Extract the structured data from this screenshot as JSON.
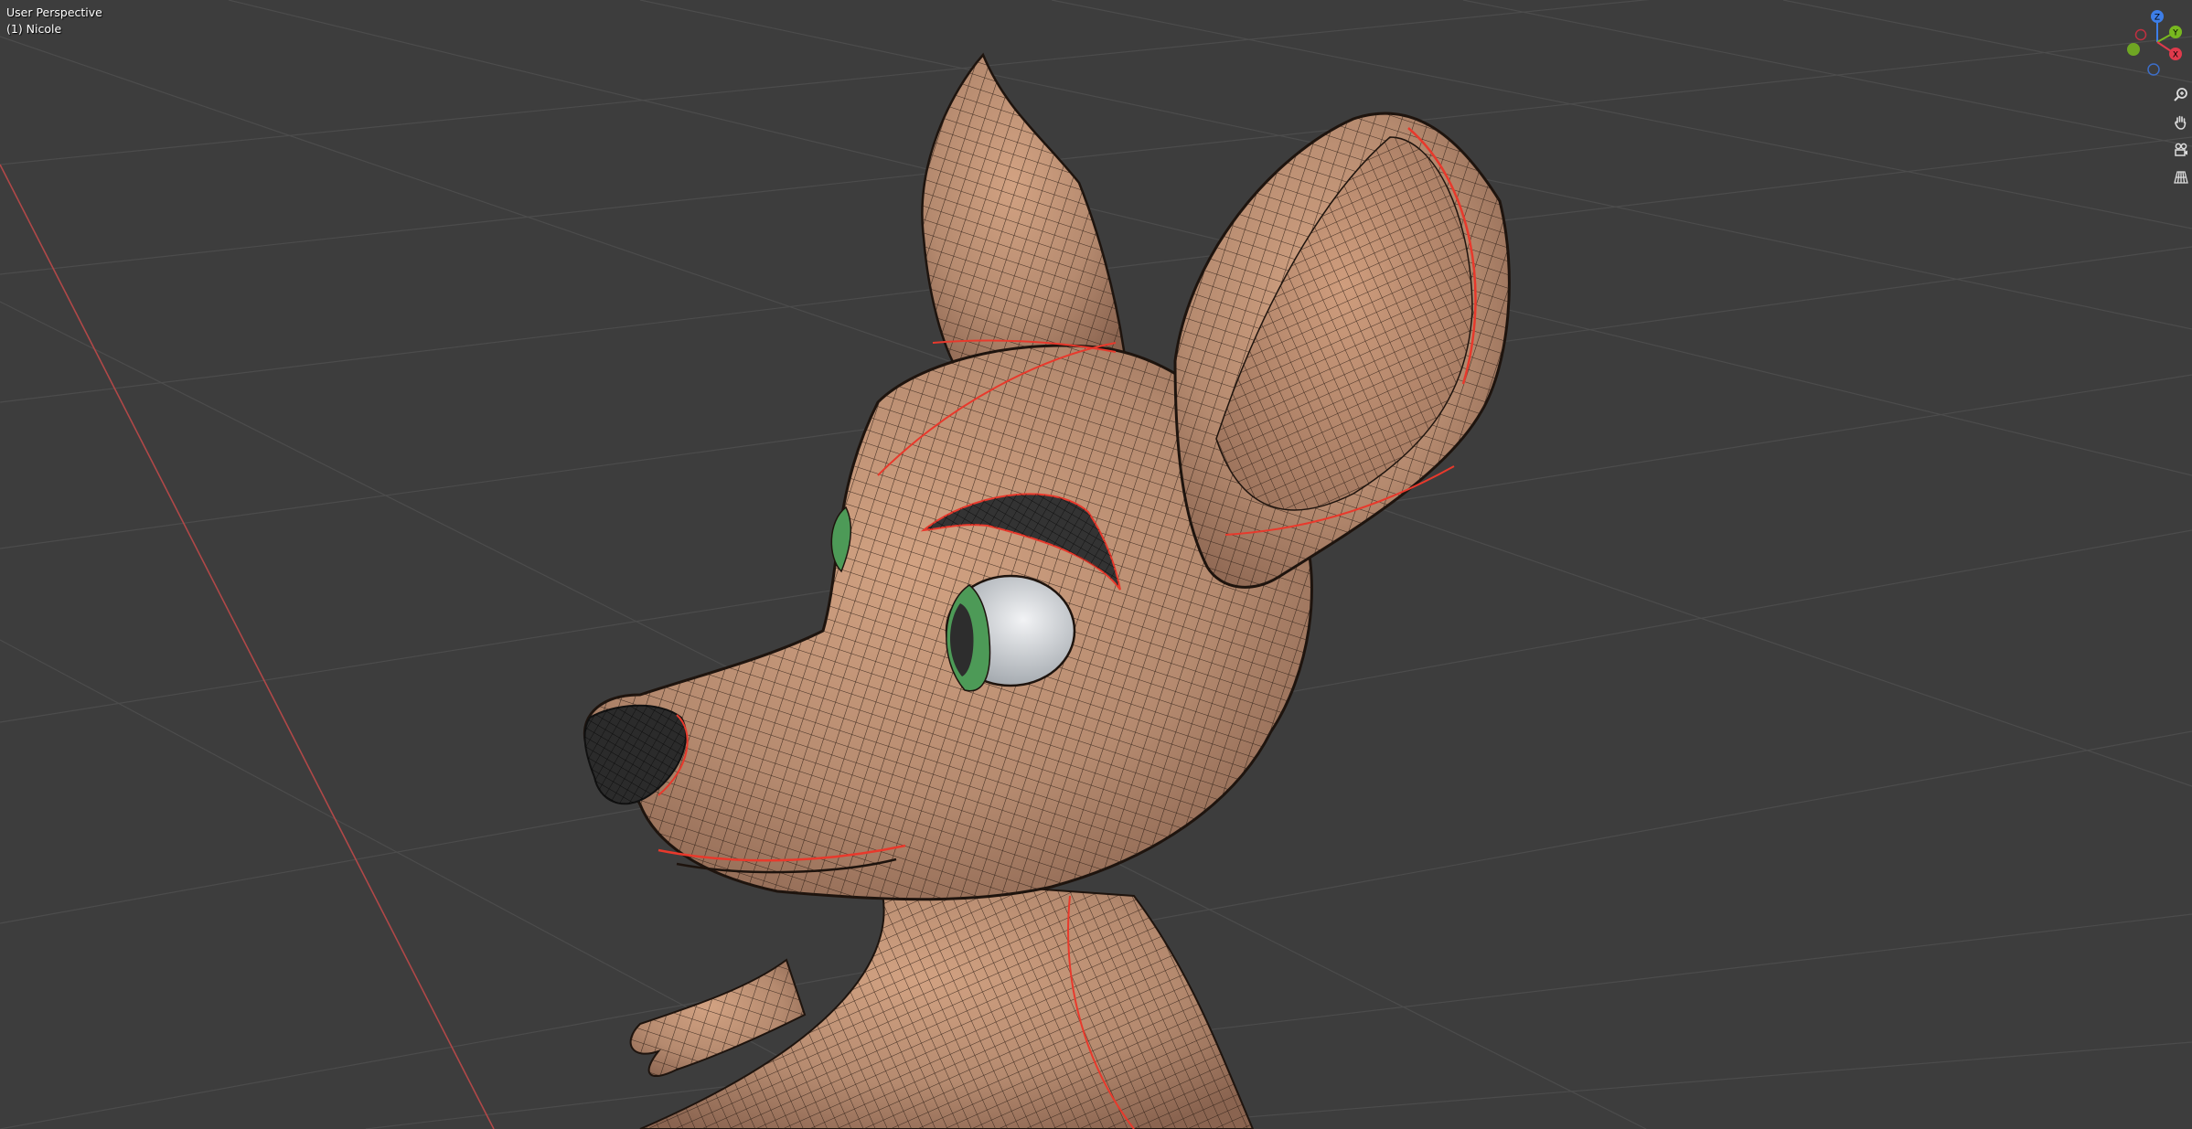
{
  "viewport": {
    "view_name": "User Perspective",
    "object_name": "(1) Nicole"
  },
  "gizmo": {
    "axes": [
      {
        "label": "Z",
        "color": "#3d7ee8"
      },
      {
        "label": "Y",
        "color": "#78b81f"
      },
      {
        "label": "X",
        "color": "#e03a4c"
      }
    ]
  },
  "navigation": {
    "tools": [
      {
        "icon": "zoom-icon"
      },
      {
        "icon": "pan-hand-icon"
      },
      {
        "icon": "camera-icon"
      },
      {
        "icon": "perspective-grid-icon"
      }
    ]
  },
  "colors": {
    "background": "#3d3d3d",
    "grid_line": "#4d4d4d",
    "x_axis_line": "#c04a4a",
    "mesh_skin": "#b58a6f",
    "seam": "#e8392c",
    "iris": "#4d9a57"
  }
}
